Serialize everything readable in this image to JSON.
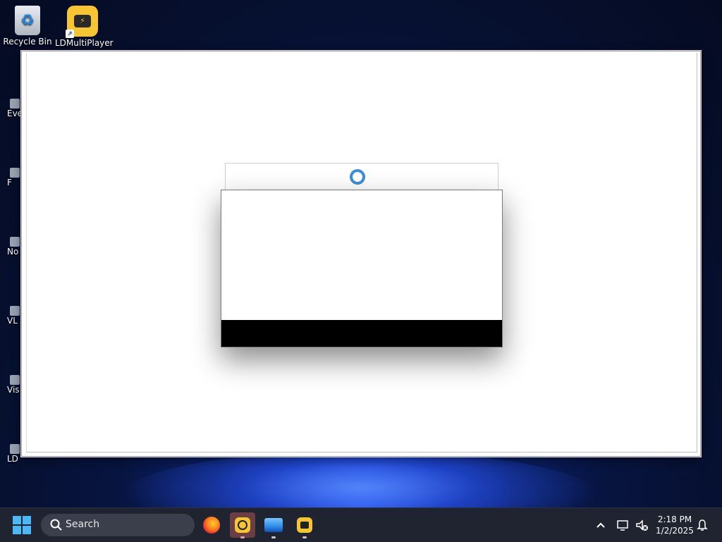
{
  "desktop": {
    "icons": [
      {
        "label": "Recycle Bin",
        "icon": "recycle-bin-icon"
      },
      {
        "label": "LDMultiPlayer",
        "icon": "ldmultiplayer-icon"
      }
    ],
    "partial_icons": [
      {
        "label": "Eve"
      },
      {
        "label": "F"
      },
      {
        "label": "No"
      },
      {
        "label": "VL"
      },
      {
        "label": "Vis"
      },
      {
        "label": "LD"
      }
    ]
  },
  "main_window": {
    "loading": {
      "icon": "spinner-icon"
    },
    "dialog": {}
  },
  "taskbar": {
    "search": {
      "placeholder": "Search"
    },
    "apps": [
      {
        "name": "Firefox",
        "icon": "firefox-icon"
      },
      {
        "name": "LDPlayer",
        "icon": "ldplayer-icon",
        "active": true
      },
      {
        "name": "Photos",
        "icon": "photos-icon"
      },
      {
        "name": "LDMultiPlayer",
        "icon": "ldmultiplayer-icon"
      }
    ],
    "tray": {
      "time": "2:18 PM",
      "date": "1/2/2025"
    }
  },
  "colors": {
    "accent": "#4cb8f5",
    "taskbar_bg": "#1f2430",
    "active_app_bg": "#6b3e46",
    "ld_yellow": "#f7c531",
    "spinner": "#3a8fd8"
  }
}
